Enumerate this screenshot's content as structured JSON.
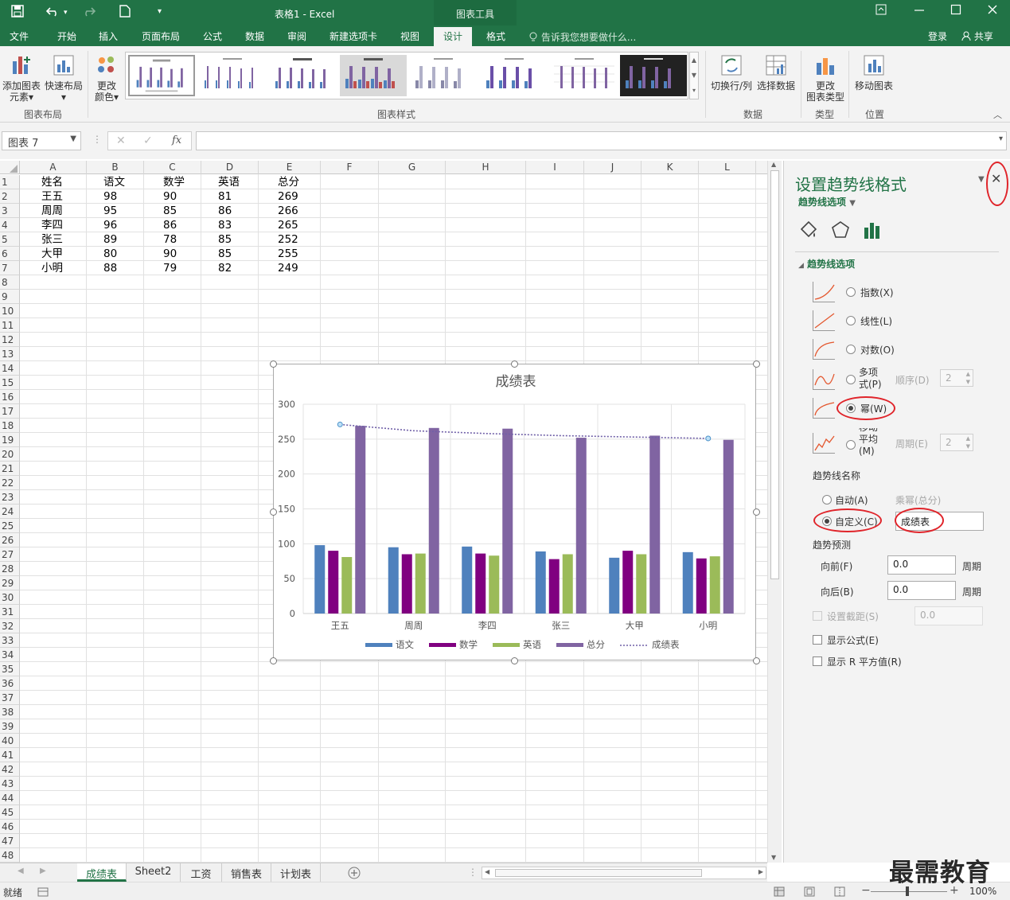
{
  "titlebar": {
    "title": "表格1 - Excel",
    "context_tools": "图表工具"
  },
  "tabs": [
    "文件",
    "开始",
    "插入",
    "页面布局",
    "公式",
    "数据",
    "审阅",
    "新建选项卡",
    "视图",
    "设计",
    "格式"
  ],
  "active_tab": "设计",
  "tell_me": "告诉我您想要做什么...",
  "login": "登录",
  "share": "共享",
  "ribbon": {
    "add_element": "添加图表元素",
    "add_element_l1": "添加图表",
    "add_element_l2": "元素",
    "quick_layout": "快速布局",
    "change_color_l1": "更改",
    "change_color_l2": "颜色",
    "group_layout": "图表布局",
    "group_styles": "图表样式",
    "switch_rowcol": "切换行/列",
    "select_data": "选择数据",
    "group_data": "数据",
    "change_type_l1": "更改",
    "change_type_l2": "图表类型",
    "group_type": "类型",
    "move_chart": "移动图表",
    "group_position": "位置"
  },
  "formula": {
    "namebox": "图表 7",
    "fx": "fx",
    "cancel": "✕",
    "confirm": "✓",
    "value": ""
  },
  "columns": [
    "A",
    "B",
    "C",
    "D",
    "E",
    "F",
    "G",
    "H",
    "I",
    "J",
    "K",
    "L"
  ],
  "rows": [
    "1",
    "2",
    "3",
    "4",
    "5",
    "6",
    "7",
    "8",
    "9",
    "10",
    "11",
    "12",
    "13",
    "14",
    "15",
    "16",
    "17",
    "18",
    "19",
    "20",
    "21",
    "22",
    "23",
    "24",
    "25",
    "26",
    "27",
    "28",
    "29",
    "30",
    "31",
    "32",
    "33",
    "34",
    "35",
    "36",
    "37",
    "38",
    "39",
    "40",
    "41",
    "42",
    "43",
    "44",
    "45",
    "46",
    "47",
    "48"
  ],
  "table": {
    "header": [
      "姓名",
      "语文",
      "数学",
      "英语",
      "总分"
    ],
    "rows": [
      [
        "王五",
        "98",
        "90",
        "81",
        "269"
      ],
      [
        "周周",
        "95",
        "85",
        "86",
        "266"
      ],
      [
        "李四",
        "96",
        "86",
        "83",
        "265"
      ],
      [
        "张三",
        "89",
        "78",
        "85",
        "252"
      ],
      [
        "大甲",
        "80",
        "90",
        "85",
        "255"
      ],
      [
        "小明",
        "88",
        "79",
        "82",
        "249"
      ]
    ]
  },
  "chart_data": {
    "type": "bar",
    "title": "成绩表",
    "categories": [
      "王五",
      "周周",
      "李四",
      "张三",
      "大甲",
      "小明"
    ],
    "series": [
      {
        "name": "语文",
        "values": [
          98,
          95,
          96,
          89,
          80,
          88
        ],
        "color": "#4f81bd"
      },
      {
        "name": "数学",
        "values": [
          90,
          85,
          86,
          78,
          90,
          79
        ],
        "color": "#800080"
      },
      {
        "name": "英语",
        "values": [
          81,
          86,
          83,
          85,
          85,
          82
        ],
        "color": "#9bbb59"
      },
      {
        "name": "总分",
        "values": [
          269,
          266,
          265,
          252,
          255,
          249
        ],
        "color": "#8064a2"
      }
    ],
    "trendline": {
      "name": "成绩表",
      "type": "power",
      "series": "总分",
      "color": "#7060a8",
      "values": [
        271,
        262,
        258,
        255,
        253,
        251
      ]
    },
    "yticks": [
      "0",
      "50",
      "100",
      "150",
      "200",
      "250",
      "300"
    ],
    "ylim": [
      0,
      300
    ],
    "grid": true,
    "legend": "bottom"
  },
  "pane": {
    "title": "设置趋势线格式",
    "subtitle": "趋势线选项",
    "section": "趋势线选项",
    "opt_exp": "指数(X)",
    "opt_linear": "线性(L)",
    "opt_log": "对数(O)",
    "opt_poly_l1": "多项",
    "opt_poly_l2": "式(P)",
    "order_label": "顺序(D)",
    "order_value": "2",
    "opt_power": "幂(W)",
    "opt_ma_l1": "移动",
    "opt_ma_l2": "平均",
    "opt_ma_l3": "(M)",
    "period_label": "周期(E)",
    "period_value": "2",
    "name_title": "趋势线名称",
    "name_auto": "自动(A)",
    "auto_value": "乘幂(总分)",
    "name_custom": "自定义(C)",
    "custom_value": "成绩表",
    "forecast_title": "趋势预测",
    "forward_label": "向前(F)",
    "forward_value": "0.0",
    "forward_unit": "周期",
    "backward_label": "向后(B)",
    "backward_value": "0.0",
    "backward_unit": "周期",
    "intercept_label": "设置截距(S)",
    "intercept_value": "0.0",
    "show_eq": "显示公式(E)",
    "show_r2": "显示 R 平方值(R)"
  },
  "sheets": [
    "成绩表",
    "Sheet2",
    "工资",
    "销售表",
    "计划表"
  ],
  "active_sheet": "成绩表",
  "status": {
    "ready": "就绪",
    "zoom": "100%"
  },
  "watermark": "最需教育"
}
